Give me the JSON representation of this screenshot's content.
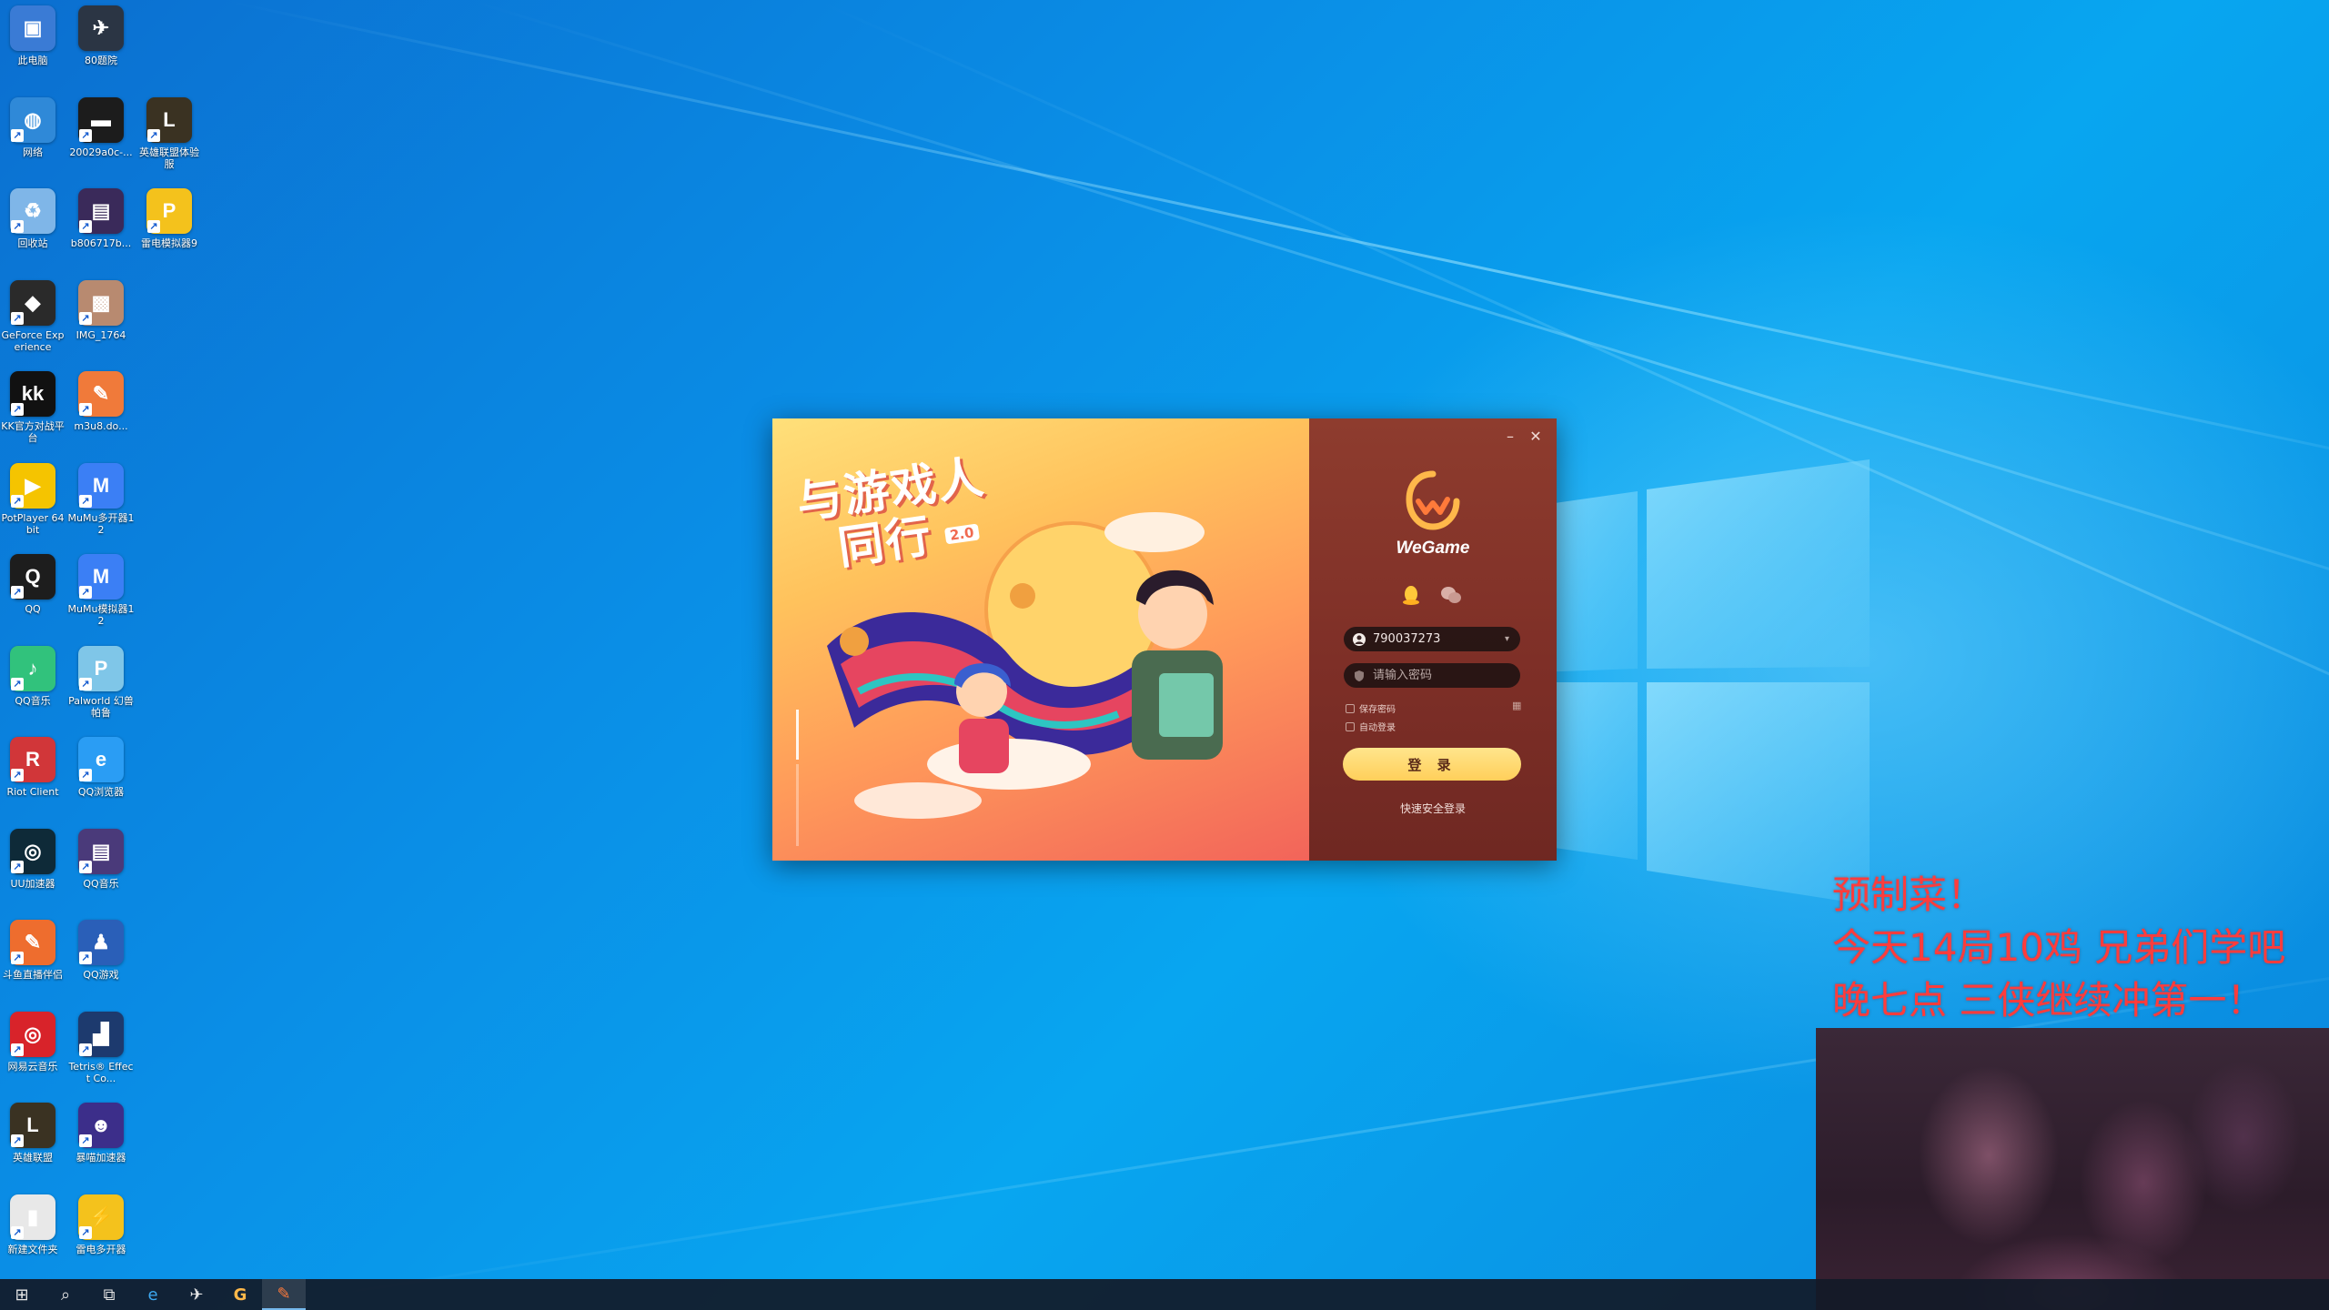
{
  "desktop_icons": [
    {
      "label": "此电脑",
      "color": "#3a7bd5",
      "glyph": "▣"
    },
    {
      "label": "80题院",
      "color": "#2b3544",
      "glyph": "✈"
    },
    {
      "label": "网络",
      "color": "#2f89d8",
      "glyph": "◍"
    },
    {
      "label": "20029a0c-...",
      "color": "#1c1c1c",
      "glyph": "▬"
    },
    {
      "label": "英雄联盟体验服",
      "color": "#3a3222",
      "glyph": "L"
    },
    {
      "label": "回收站",
      "color": "#7fb6e8",
      "glyph": "♻"
    },
    {
      "label": "b806717b...",
      "color": "#3a2a5a",
      "glyph": "▤"
    },
    {
      "label": "雷电模拟器9",
      "color": "#f4c21c",
      "glyph": "P"
    },
    {
      "label": "GeForce Experience",
      "color": "#2a2a2a",
      "glyph": "◆"
    },
    {
      "label": "IMG_1764",
      "color": "#b88a70",
      "glyph": "▩"
    },
    {
      "label": "KK官方对战平台",
      "color": "#111111",
      "glyph": "kk"
    },
    {
      "label": "m3u8.do...",
      "color": "#f07a3a",
      "glyph": "✎"
    },
    {
      "label": "PotPlayer 64 bit",
      "color": "#f5c400",
      "glyph": "▶"
    },
    {
      "label": "MuMu多开器12",
      "color": "#3b7ff5",
      "glyph": "M"
    },
    {
      "label": "QQ",
      "color": "#1d1d1d",
      "glyph": "Q"
    },
    {
      "label": "MuMu模拟器12",
      "color": "#3b7ff5",
      "glyph": "M"
    },
    {
      "label": "QQ音乐",
      "color": "#31c27c",
      "glyph": "♪"
    },
    {
      "label": "Palworld 幻兽帕鲁",
      "color": "#7fc6e8",
      "glyph": "P"
    },
    {
      "label": "Riot Client",
      "color": "#d13639",
      "glyph": "R"
    },
    {
      "label": "QQ浏览器",
      "color": "#2a9df4",
      "glyph": "e"
    },
    {
      "label": "UU加速器",
      "color": "#0e2a38",
      "glyph": "◎"
    },
    {
      "label": "QQ音乐",
      "color": "#4a3a7a",
      "glyph": "▤"
    },
    {
      "label": "斗鱼直播伴侣",
      "color": "#ee6d2e",
      "glyph": "✎"
    },
    {
      "label": "QQ游戏",
      "color": "#2a5fb8",
      "glyph": "♟"
    },
    {
      "label": "网易云音乐",
      "color": "#d8232a",
      "glyph": "◎"
    },
    {
      "label": "Tetris® Effect Co...",
      "color": "#1d3a6e",
      "glyph": "▟"
    },
    {
      "label": "英雄联盟",
      "color": "#3a3222",
      "glyph": "L"
    },
    {
      "label": "暴喵加速器",
      "color": "#3c2e8a",
      "glyph": "☻"
    },
    {
      "label": "新建文件夹",
      "color": "#e8e8e8",
      "glyph": "▮"
    },
    {
      "label": "雷电多开器",
      "color": "#f4c21c",
      "glyph": "⚡"
    }
  ],
  "taskbar": {
    "items": [
      {
        "name": "start-icon",
        "glyph": "⊞"
      },
      {
        "name": "search-icon",
        "glyph": "⌕"
      },
      {
        "name": "task-view-icon",
        "glyph": "⧉"
      },
      {
        "name": "edge-icon",
        "glyph": "e"
      },
      {
        "name": "feishu-icon",
        "glyph": "✈"
      },
      {
        "name": "wegame-taskbar-icon",
        "glyph": "G"
      },
      {
        "name": "douyu-icon",
        "glyph": "✎"
      }
    ]
  },
  "wegame": {
    "slogan_line1": "与游戏人",
    "slogan_line2": "同行",
    "version_badge": "2.0",
    "brand": "WeGame",
    "account_value": "790037273",
    "password_placeholder": "请输入密码",
    "remember_password": "保存密码",
    "auto_login": "自动登录",
    "login_button": "登 录",
    "quick_login": "快速安全登录",
    "accent": "#ffd56a"
  },
  "overlay": {
    "line1": "预制菜！",
    "line2": "今天14局10鸡 兄弟们学吧",
    "line3": "晚七点 三侠继续冲第一！"
  }
}
